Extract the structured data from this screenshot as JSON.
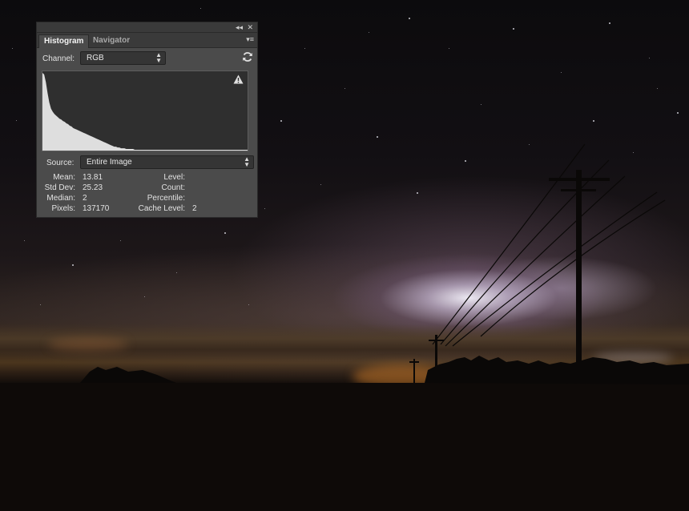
{
  "panel": {
    "tabs": [
      {
        "label": "Histogram",
        "active": true
      },
      {
        "label": "Navigator",
        "active": false
      }
    ],
    "channel": {
      "label": "Channel:",
      "value": "RGB"
    },
    "source": {
      "label": "Source:",
      "value": "Entire Image"
    },
    "statistics": [
      {
        "label": "Mean:",
        "value": "13.81"
      },
      {
        "label": "Std Dev:",
        "value": "25.23"
      },
      {
        "label": "Median:",
        "value": "2"
      },
      {
        "label": "Pixels:",
        "value": "137170"
      }
    ],
    "level_info": [
      {
        "label": "Level:",
        "value": ""
      },
      {
        "label": "Count:",
        "value": ""
      },
      {
        "label": "Percentile:",
        "value": ""
      },
      {
        "label": "Cache Level:",
        "value": "2"
      }
    ],
    "icons": {
      "collapse": "double-chevron-left-icon",
      "close": "close-icon",
      "menu": "panel-menu-icon",
      "refresh": "refresh-icon",
      "warning": "cache-warning-icon"
    },
    "histogram_levels": [
      100,
      98,
      88,
      74,
      62,
      54,
      50,
      47,
      45,
      43,
      41,
      40,
      38,
      37,
      35,
      34,
      32,
      31,
      29,
      28,
      27,
      26,
      25,
      24,
      23,
      22,
      21,
      20,
      19,
      18,
      17,
      16,
      15,
      14,
      13,
      12,
      11,
      10,
      9,
      8,
      7,
      6,
      5,
      5,
      4,
      4,
      3,
      3,
      3,
      2,
      2,
      2,
      2,
      2,
      1,
      1,
      1,
      1,
      1,
      1
    ]
  },
  "colors": {
    "panel_bg": "#4b4b4b",
    "histogram_fill": "#dedede",
    "graph_bg": "#2f2f2f"
  }
}
